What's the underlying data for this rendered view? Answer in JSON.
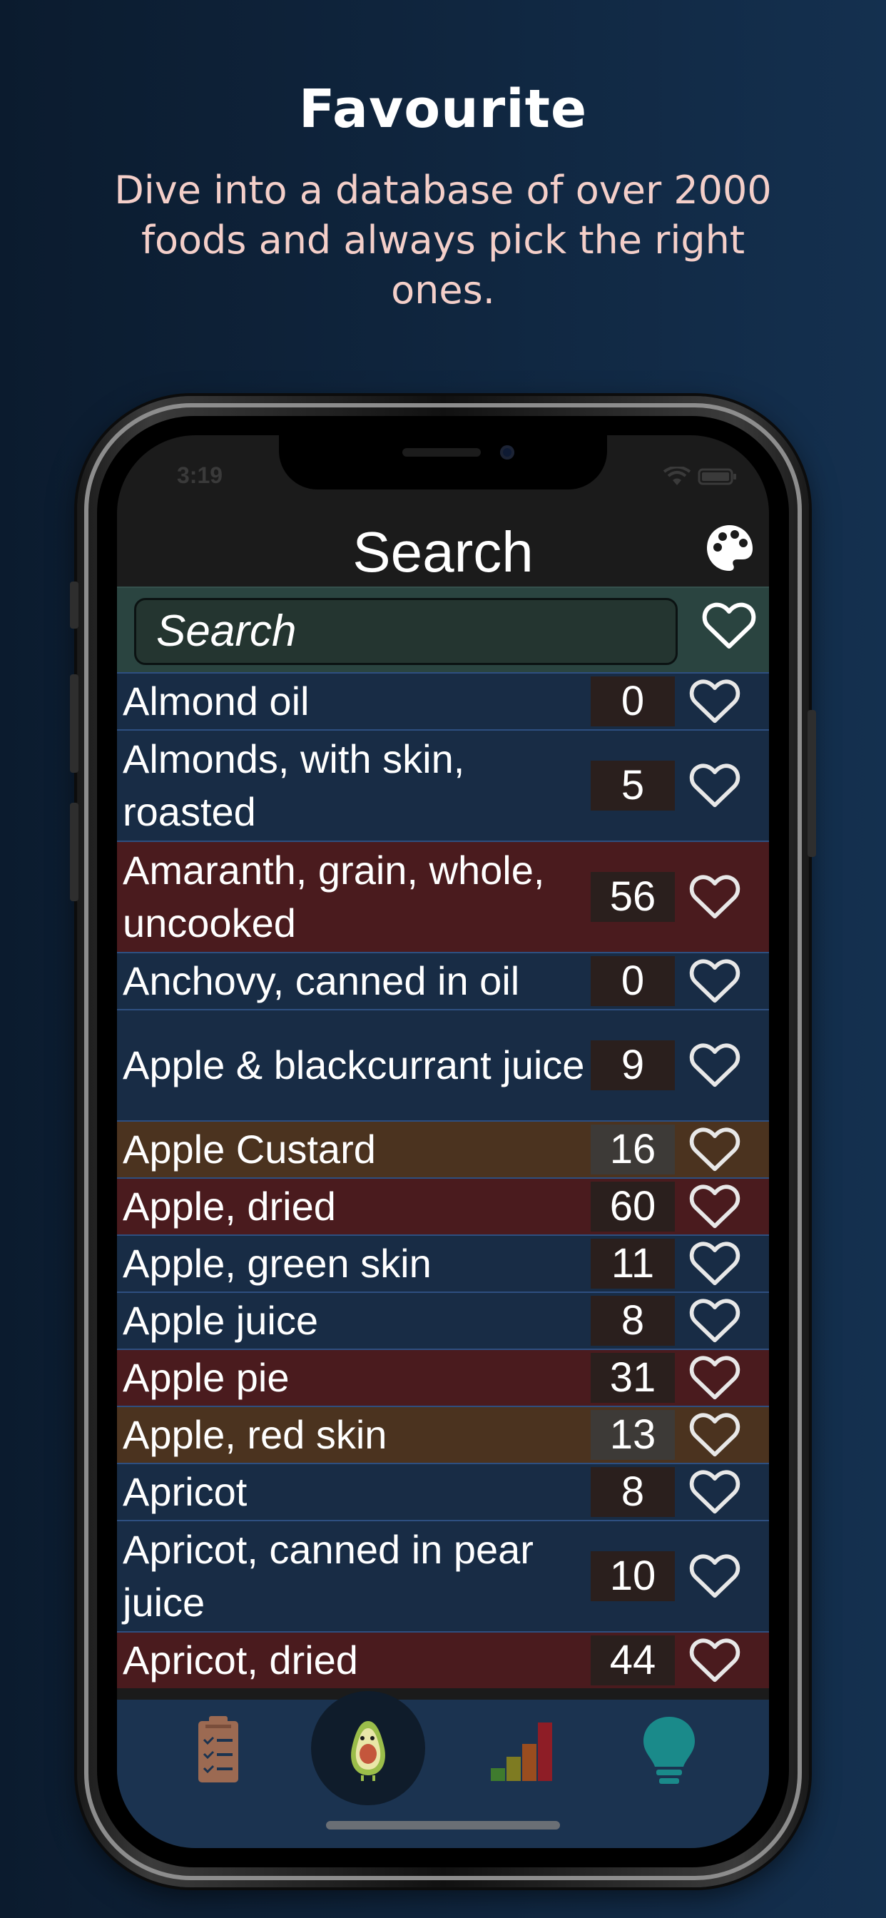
{
  "hero": {
    "title": "Favourite",
    "subtitle": "Dive into a database of over 2000 foods and always pick the right ones."
  },
  "status_bar": {
    "time": "3:19"
  },
  "nav": {
    "title": "Search",
    "palette_icon": "palette-icon"
  },
  "search": {
    "placeholder": "Search",
    "favourite_filter_icon": "heart-outline-icon"
  },
  "colors": {
    "row_blue": "#182c45",
    "row_red": "#4a1b1e",
    "row_orange": "#4b331f",
    "value_dark": "#2a1f1d",
    "value_gray": "#3d3a37",
    "divider": "#2e4f80"
  },
  "foods": [
    {
      "name": "Almond oil",
      "value": "0",
      "tone": "blue"
    },
    {
      "name": "Almonds, with skin, roasted",
      "value": "5",
      "tone": "blue"
    },
    {
      "name": "Amaranth, grain, whole, uncooked",
      "value": "56",
      "tone": "red"
    },
    {
      "name": "Anchovy, canned in oil",
      "value": "0",
      "tone": "blue"
    },
    {
      "name": "Apple & blackcurrant juice",
      "value": "9",
      "tone": "blue"
    },
    {
      "name": "Apple Custard",
      "value": "16",
      "tone": "orange"
    },
    {
      "name": "Apple, dried",
      "value": "60",
      "tone": "red"
    },
    {
      "name": "Apple, green skin",
      "value": "11",
      "tone": "blue"
    },
    {
      "name": "Apple juice",
      "value": "8",
      "tone": "blue"
    },
    {
      "name": "Apple pie",
      "value": "31",
      "tone": "red"
    },
    {
      "name": "Apple, red skin",
      "value": "13",
      "tone": "orange"
    },
    {
      "name": "Apricot",
      "value": "8",
      "tone": "blue"
    },
    {
      "name": "Apricot, canned in pear juice",
      "value": "10",
      "tone": "blue"
    },
    {
      "name": "Apricot, dried",
      "value": "44",
      "tone": "red"
    }
  ],
  "tabs": [
    {
      "icon": "clipboard-icon"
    },
    {
      "icon": "avocado-icon",
      "active": true
    },
    {
      "icon": "bar-chart-icon"
    },
    {
      "icon": "lightbulb-icon"
    }
  ]
}
